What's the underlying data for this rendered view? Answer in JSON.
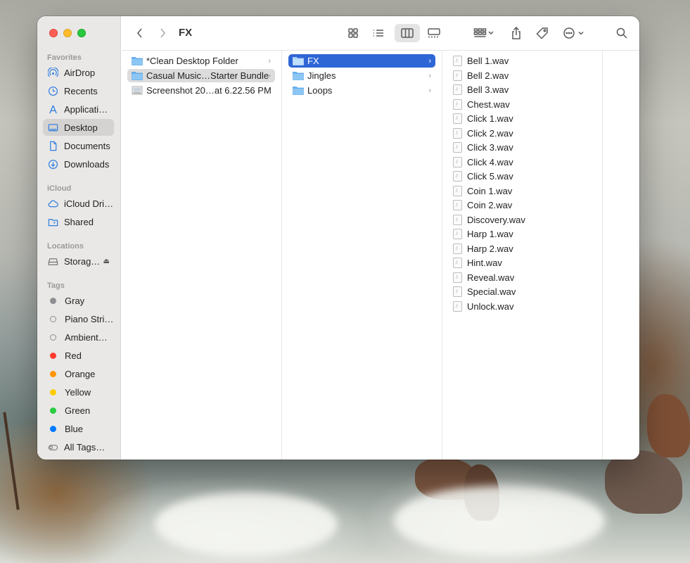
{
  "window": {
    "title": "FX"
  },
  "sidebar": {
    "favorites_label": "Favorites",
    "favorites": [
      {
        "label": "AirDrop",
        "icon": "airdrop-icon"
      },
      {
        "label": "Recents",
        "icon": "clock-icon"
      },
      {
        "label": "Applicati…",
        "icon": "applications-icon"
      },
      {
        "label": "Desktop",
        "icon": "desktop-icon",
        "selected": true
      },
      {
        "label": "Documents",
        "icon": "document-icon"
      },
      {
        "label": "Downloads",
        "icon": "download-icon"
      }
    ],
    "icloud_label": "iCloud",
    "icloud": [
      {
        "label": "iCloud Dri…",
        "icon": "cloud-icon"
      },
      {
        "label": "Shared",
        "icon": "shared-folder-icon"
      }
    ],
    "locations_label": "Locations",
    "locations": [
      {
        "label": "Storag…",
        "icon": "drive-icon"
      }
    ],
    "tags_label": "Tags",
    "tags": [
      {
        "label": "Gray",
        "color": "#8e8e93"
      },
      {
        "label": "Piano Stri…",
        "color": "hollow"
      },
      {
        "label": "Ambient…",
        "color": "hollow"
      },
      {
        "label": "Red",
        "color": "#ff3b30"
      },
      {
        "label": "Orange",
        "color": "#ff9500"
      },
      {
        "label": "Yellow",
        "color": "#ffcc00"
      },
      {
        "label": "Green",
        "color": "#28cd41"
      },
      {
        "label": "Blue",
        "color": "#007aff"
      },
      {
        "label": "All Tags…",
        "color": "all"
      }
    ]
  },
  "columns": {
    "col1": [
      {
        "label": "*Clean Desktop Folder",
        "type": "folder",
        "chevron": "›"
      },
      {
        "label": "Casual Music…Starter Bundle",
        "type": "folder",
        "chevron": "›",
        "selected": "gray"
      },
      {
        "label": "Screenshot 20…at 6.22.56 PM",
        "type": "image"
      }
    ],
    "col2": [
      {
        "label": "FX",
        "type": "folder",
        "chevron": "›",
        "selected": "blue"
      },
      {
        "label": "Jingles",
        "type": "folder",
        "chevron": "›"
      },
      {
        "label": "Loops",
        "type": "folder",
        "chevron": "›"
      }
    ],
    "col3": [
      "Bell 1.wav",
      "Bell 2.wav",
      "Bell 3.wav",
      "Chest.wav",
      "Click 1.wav",
      "Click 2.wav",
      "Click 3.wav",
      "Click 4.wav",
      "Click 5.wav",
      "Coin 1.wav",
      "Coin 2.wav",
      "Discovery.wav",
      "Harp 1.wav",
      "Harp 2.wav",
      "Hint.wav",
      "Reveal.wav",
      "Special.wav",
      "Unlock.wav"
    ]
  },
  "colors": {
    "accent": "#2f66d6",
    "sidebar_bg": "#e9e8e6"
  }
}
